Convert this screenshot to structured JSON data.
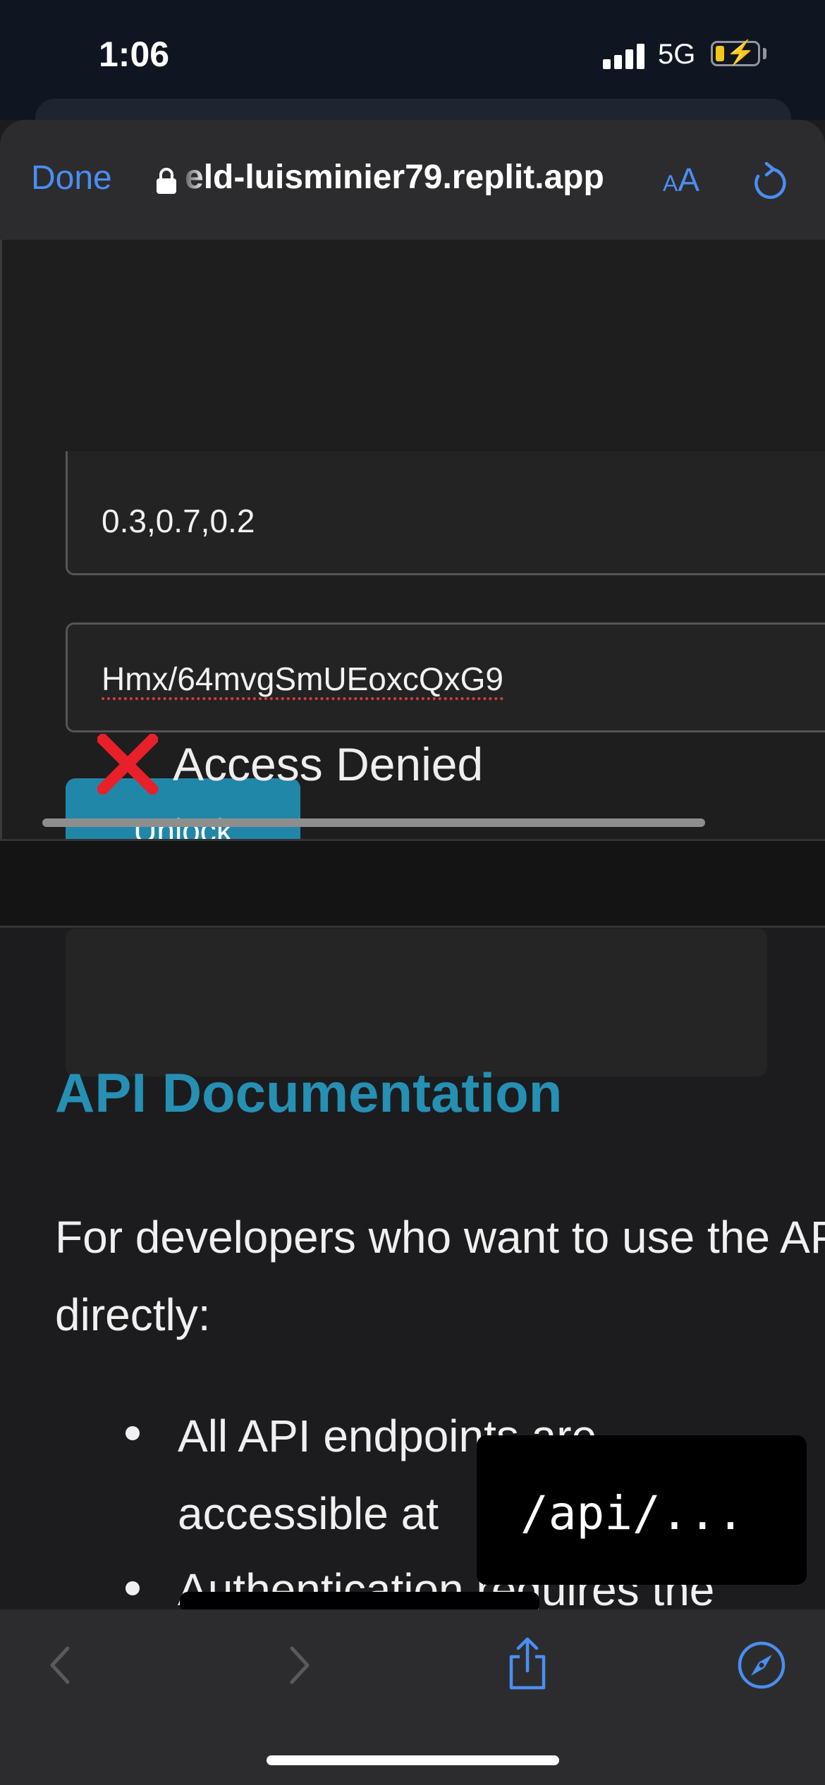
{
  "status_bar": {
    "time": "1:06",
    "network": "5G"
  },
  "browser": {
    "done_label": "Done",
    "url": "eld-luisminier79.replit.app",
    "reader_small": "A",
    "reader_large": "A"
  },
  "form": {
    "field1_value": "0.3,0.7,0.2",
    "field2_value": "Hmx/64mvgSmUEoxcQxG9",
    "unlock_label": "Unlock",
    "result_text": "Access Denied"
  },
  "docs": {
    "heading": "API Documentation",
    "intro": "For developers who want to use the API directly:",
    "bullets": [
      {
        "line1": "All API endpoints are",
        "line2": "accessible at"
      },
      {
        "line1": "Authentication requires the"
      }
    ],
    "code_popup": "/api/..."
  },
  "colors": {
    "accent": "#2590b4",
    "link_blue": "#4a8ef0",
    "button_bg": "#2187a8",
    "error_red": "#e8202a"
  },
  "icons": [
    "lock-icon",
    "reload-icon",
    "cross-icon",
    "back-icon",
    "forward-icon",
    "share-icon",
    "compass-icon"
  ]
}
